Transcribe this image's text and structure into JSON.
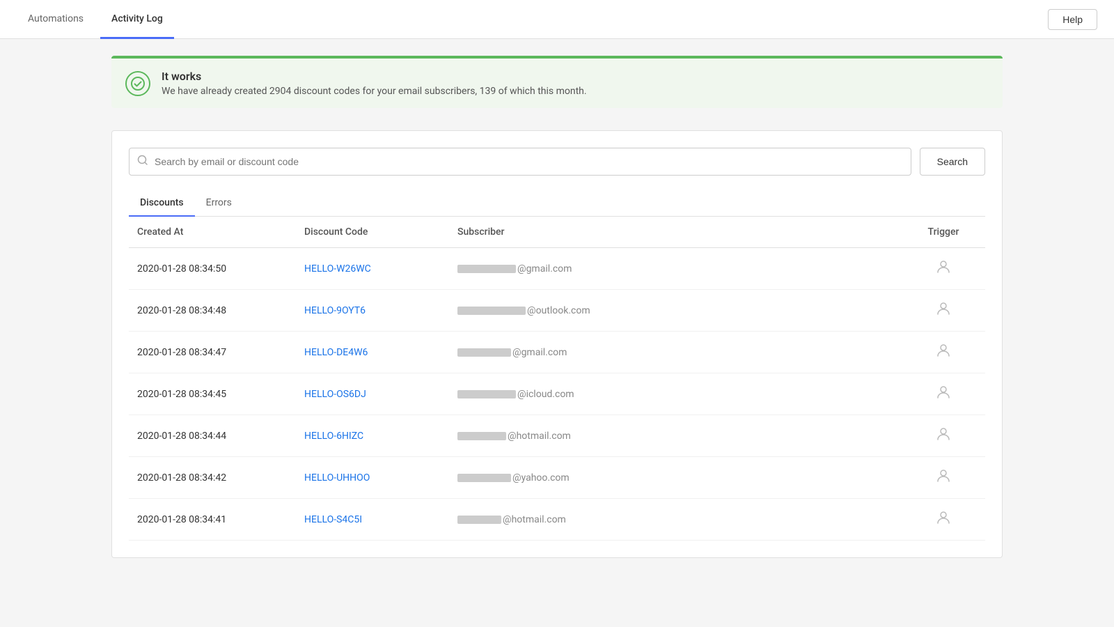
{
  "nav": {
    "tabs": [
      {
        "id": "automations",
        "label": "Automations",
        "active": false
      },
      {
        "id": "activity-log",
        "label": "Activity Log",
        "active": true
      }
    ],
    "help_label": "Help"
  },
  "banner": {
    "title": "It works",
    "description": "We have already created 2904 discount codes for your email subscribers, 139 of which this month."
  },
  "search": {
    "placeholder": "Search by email or discount code",
    "button_label": "Search"
  },
  "content_tabs": [
    {
      "id": "discounts",
      "label": "Discounts",
      "active": true
    },
    {
      "id": "errors",
      "label": "Errors",
      "active": false
    }
  ],
  "table": {
    "columns": [
      "Created At",
      "Discount Code",
      "Subscriber",
      "Trigger"
    ],
    "rows": [
      {
        "created_at": "2020-01-28 08:34:50",
        "discount_code": "HELLO-W26WC",
        "subscriber_suffix": "@gmail.com",
        "subscriber_prefix_length": 12
      },
      {
        "created_at": "2020-01-28 08:34:48",
        "discount_code": "HELLO-9OYT6",
        "subscriber_suffix": "@outlook.com",
        "subscriber_prefix_length": 14
      },
      {
        "created_at": "2020-01-28 08:34:47",
        "discount_code": "HELLO-DE4W6",
        "subscriber_suffix": "@gmail.com",
        "subscriber_prefix_length": 11
      },
      {
        "created_at": "2020-01-28 08:34:45",
        "discount_code": "HELLO-OS6DJ",
        "subscriber_suffix": "@icloud.com",
        "subscriber_prefix_length": 12
      },
      {
        "created_at": "2020-01-28 08:34:44",
        "discount_code": "HELLO-6HIZC",
        "subscriber_suffix": "@hotmail.com",
        "subscriber_prefix_length": 10
      },
      {
        "created_at": "2020-01-28 08:34:42",
        "discount_code": "HELLO-UHHOO",
        "subscriber_suffix": "@yahoo.com",
        "subscriber_prefix_length": 11
      },
      {
        "created_at": "2020-01-28 08:34:41",
        "discount_code": "HELLO-S4C5I",
        "subscriber_suffix": "@hotmail.com",
        "subscriber_prefix_length": 9
      }
    ]
  }
}
